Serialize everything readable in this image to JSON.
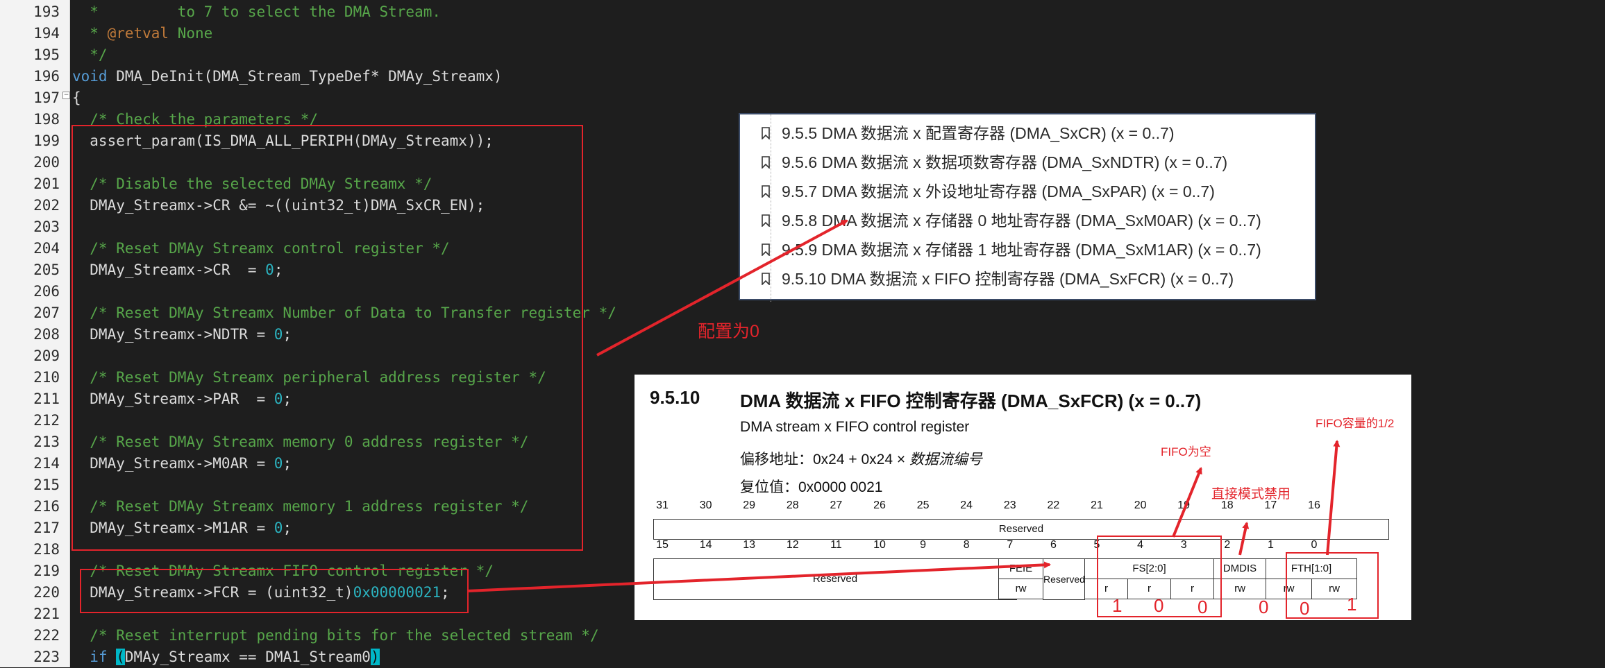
{
  "editor": {
    "lines": [
      {
        "num": "193",
        "parts": [
          {
            "t": "  *         to 7 to select the DMA Stream.",
            "c": "cm"
          }
        ]
      },
      {
        "num": "194",
        "parts": [
          {
            "t": "  * ",
            "c": "cm"
          },
          {
            "t": "@retval",
            "c": "tag"
          },
          {
            "t": " None",
            "c": "cm"
          }
        ]
      },
      {
        "num": "195",
        "parts": [
          {
            "t": "  */",
            "c": "cm"
          }
        ]
      },
      {
        "num": "196",
        "parts": [
          {
            "t": "void",
            "c": "kw"
          },
          {
            "t": " DMA_DeInit(DMA_Stream_TypeDef* DMAy_Streamx)",
            "c": ""
          }
        ]
      },
      {
        "num": "197",
        "parts": [
          {
            "t": "{",
            "c": ""
          }
        ]
      },
      {
        "num": "198",
        "parts": [
          {
            "t": "  /* Check the parameters */",
            "c": "cm"
          }
        ]
      },
      {
        "num": "199",
        "parts": [
          {
            "t": "  assert_param(IS_DMA_ALL_PERIPH(DMAy_Streamx));",
            "c": ""
          }
        ]
      },
      {
        "num": "200",
        "parts": []
      },
      {
        "num": "201",
        "parts": [
          {
            "t": "  /* Disable the selected DMAy Streamx */",
            "c": "cm"
          }
        ]
      },
      {
        "num": "202",
        "parts": [
          {
            "t": "  DMAy_Streamx->CR &= ~((uint32_t)DMA_SxCR_EN);",
            "c": ""
          }
        ]
      },
      {
        "num": "203",
        "parts": []
      },
      {
        "num": "204",
        "parts": [
          {
            "t": "  /* Reset DMAy Streamx control register */",
            "c": "cm"
          }
        ]
      },
      {
        "num": "205",
        "parts": [
          {
            "t": "  DMAy_Streamx->CR  = ",
            "c": ""
          },
          {
            "t": "0",
            "c": "num"
          },
          {
            "t": ";",
            "c": ""
          }
        ]
      },
      {
        "num": "206",
        "parts": []
      },
      {
        "num": "207",
        "parts": [
          {
            "t": "  /* Reset DMAy Streamx Number of Data to Transfer register */",
            "c": "cm"
          }
        ]
      },
      {
        "num": "208",
        "parts": [
          {
            "t": "  DMAy_Streamx->NDTR = ",
            "c": ""
          },
          {
            "t": "0",
            "c": "num"
          },
          {
            "t": ";",
            "c": ""
          }
        ]
      },
      {
        "num": "209",
        "parts": []
      },
      {
        "num": "210",
        "parts": [
          {
            "t": "  /* Reset DMAy Streamx peripheral address register */",
            "c": "cm"
          }
        ]
      },
      {
        "num": "211",
        "parts": [
          {
            "t": "  DMAy_Streamx->PAR  = ",
            "c": ""
          },
          {
            "t": "0",
            "c": "num"
          },
          {
            "t": ";",
            "c": ""
          }
        ]
      },
      {
        "num": "212",
        "parts": []
      },
      {
        "num": "213",
        "parts": [
          {
            "t": "  /* Reset DMAy Streamx memory 0 address register */",
            "c": "cm"
          }
        ]
      },
      {
        "num": "214",
        "parts": [
          {
            "t": "  DMAy_Streamx->M0AR = ",
            "c": ""
          },
          {
            "t": "0",
            "c": "num"
          },
          {
            "t": ";",
            "c": ""
          }
        ]
      },
      {
        "num": "215",
        "parts": []
      },
      {
        "num": "216",
        "parts": [
          {
            "t": "  /* Reset DMAy Streamx memory 1 address register */",
            "c": "cm"
          }
        ]
      },
      {
        "num": "217",
        "parts": [
          {
            "t": "  DMAy_Streamx->M1AR = ",
            "c": ""
          },
          {
            "t": "0",
            "c": "num"
          },
          {
            "t": ";",
            "c": ""
          }
        ]
      },
      {
        "num": "218",
        "parts": []
      },
      {
        "num": "219",
        "parts": [
          {
            "t": "  /* Reset DMAy Streamx FIFO control register */",
            "c": "cm"
          }
        ]
      },
      {
        "num": "220",
        "parts": [
          {
            "t": "  DMAy_Streamx->FCR = (uint32_t)",
            "c": ""
          },
          {
            "t": "0x00000021",
            "c": "num"
          },
          {
            "t": ";",
            "c": ""
          }
        ]
      },
      {
        "num": "221",
        "parts": []
      },
      {
        "num": "222",
        "parts": [
          {
            "t": "  /* Reset interrupt pending bits for the selected stream */",
            "c": "cm"
          }
        ]
      },
      {
        "num": "223",
        "parts": [
          {
            "t": "  ",
            "c": ""
          },
          {
            "t": "if",
            "c": "kw"
          },
          {
            "t": " ",
            "c": ""
          },
          {
            "t": "(",
            "c": "paren"
          },
          {
            "t": "DMAy_Streamx == DMA1_Stream0",
            "c": ""
          },
          {
            "t": ")",
            "c": "paren"
          }
        ]
      }
    ]
  },
  "bookmarks": [
    "9.5.5 DMA 数据流 x 配置寄存器 (DMA_SxCR) (x = 0..7)",
    "9.5.6 DMA 数据流 x 数据项数寄存器 (DMA_SxNDTR) (x = 0..7)",
    "9.5.7 DMA 数据流 x 外设地址寄存器 (DMA_SxPAR) (x = 0..7)",
    "9.5.8 DMA 数据流 x 存储器 0 地址寄存器 (DMA_SxM0AR) (x = 0..7)",
    "9.5.9 DMA 数据流 x 存储器 1 地址寄存器 (DMA_SxM1AR) (x = 0..7)",
    "9.5.10 DMA 数据流 x FIFO 控制寄存器 (DMA_SxFCR) (x = 0..7)"
  ],
  "register": {
    "section_num": "9.5.10",
    "title": "DMA 数据流 x FIFO 控制寄存器 (DMA_SxFCR) (x = 0..7)",
    "subtitle": "DMA stream x FIFO control register",
    "offset_label": "偏移地址：0x24 + 0x24 × ",
    "offset_italic": "数据流编号",
    "reset_label": "复位值：0x0000 0021",
    "bits_high": [
      "31",
      "30",
      "29",
      "28",
      "27",
      "26",
      "25",
      "24",
      "23",
      "22",
      "21",
      "20",
      "19",
      "18",
      "17",
      "16"
    ],
    "bits_low": [
      "15",
      "14",
      "13",
      "12",
      "11",
      "10",
      "9",
      "8",
      "7",
      "6",
      "5",
      "4",
      "3",
      "2",
      "1",
      "0"
    ],
    "reserved_high": "Reserved",
    "reserved_low": "Reserved",
    "feie": "FEIE",
    "reserved_mid": "Reserved",
    "fs": "FS[2:0]",
    "dmdis": "DMDIS",
    "fth": "FTH[1:0]",
    "access": {
      "feie": "rw",
      "fs0": "r",
      "fs1": "r",
      "fs2": "r",
      "dmdis": "rw",
      "fth0": "rw",
      "fth1": "rw"
    }
  },
  "annotations": {
    "config_zero": "配置为0",
    "fifo_half": "FIFO容量的1/2",
    "fifo_empty": "FIFO为空",
    "direct_disabled": "直接模式禁用",
    "bit5": "1",
    "bit4": "0",
    "bit3": "0",
    "bit2": "0",
    "bit1": "0",
    "bit0": "1"
  },
  "colors": {
    "annotation": "#e3242b",
    "comment": "#57a64a",
    "keyword": "#569cd6",
    "number": "#2bb3c0"
  }
}
